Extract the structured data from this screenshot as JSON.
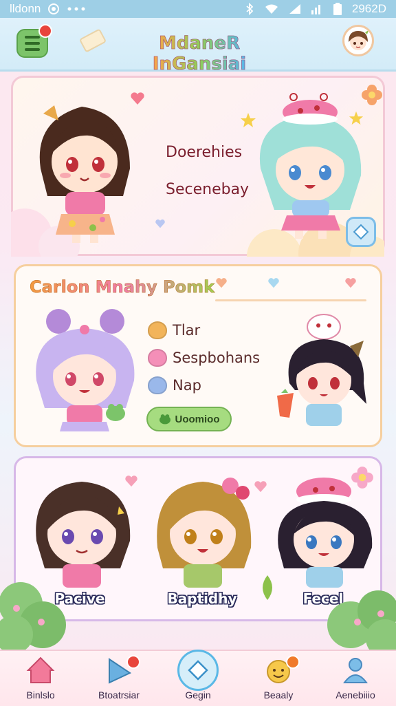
{
  "status_bar": {
    "carrier": "lldonn",
    "time": "2962D",
    "icons": [
      "camera-circle-icon",
      "dots-icon",
      "bluetooth-icon",
      "wifi-icon",
      "signal-icon",
      "signal-bars-icon",
      "battery-icon"
    ]
  },
  "app_bar": {
    "title": "MdaneR InGansiai",
    "menu_icon": "hamburger-icon",
    "profile_icon": "avatar-icon"
  },
  "hero": {
    "line1": "Doerehies",
    "line2": "Secenebay",
    "action_icon": "diamond-icon"
  },
  "feature": {
    "title": "Carlon Mnahy Pomk",
    "items": [
      {
        "label": "Tlar",
        "icon": "cookie-icon",
        "color": "#f2b45a"
      },
      {
        "label": "Sespbohans",
        "icon": "pink-blob-icon",
        "color": "#f48fb8"
      },
      {
        "label": "Nap",
        "icon": "blue-blob-icon",
        "color": "#9ab8ea"
      }
    ],
    "button_label": "Uoomioo",
    "button_icon": "frog-icon"
  },
  "characters": [
    {
      "label": "Pacive"
    },
    {
      "label": "Baptidhy"
    },
    {
      "label": "Fecel"
    }
  ],
  "bottom_nav": [
    {
      "label": "Binlslo",
      "icon": "home-icon",
      "color": "#f27a9a"
    },
    {
      "label": "Btoatrsiar",
      "icon": "flag-icon",
      "color": "#6ab0e0"
    },
    {
      "label": "Gegin",
      "icon": "diamond-icon",
      "color": "#5ab8e6"
    },
    {
      "label": "Beaaly",
      "icon": "smiley-icon",
      "color": "#f6c84a"
    },
    {
      "label": "Aenebiiio",
      "icon": "person-icon",
      "color": "#7cbde8"
    }
  ],
  "colors": {
    "accent_pink": "#f27a9a",
    "accent_blue": "#9ecfe6",
    "accent_green": "#7cc46a",
    "badge_red": "#e8453c"
  }
}
